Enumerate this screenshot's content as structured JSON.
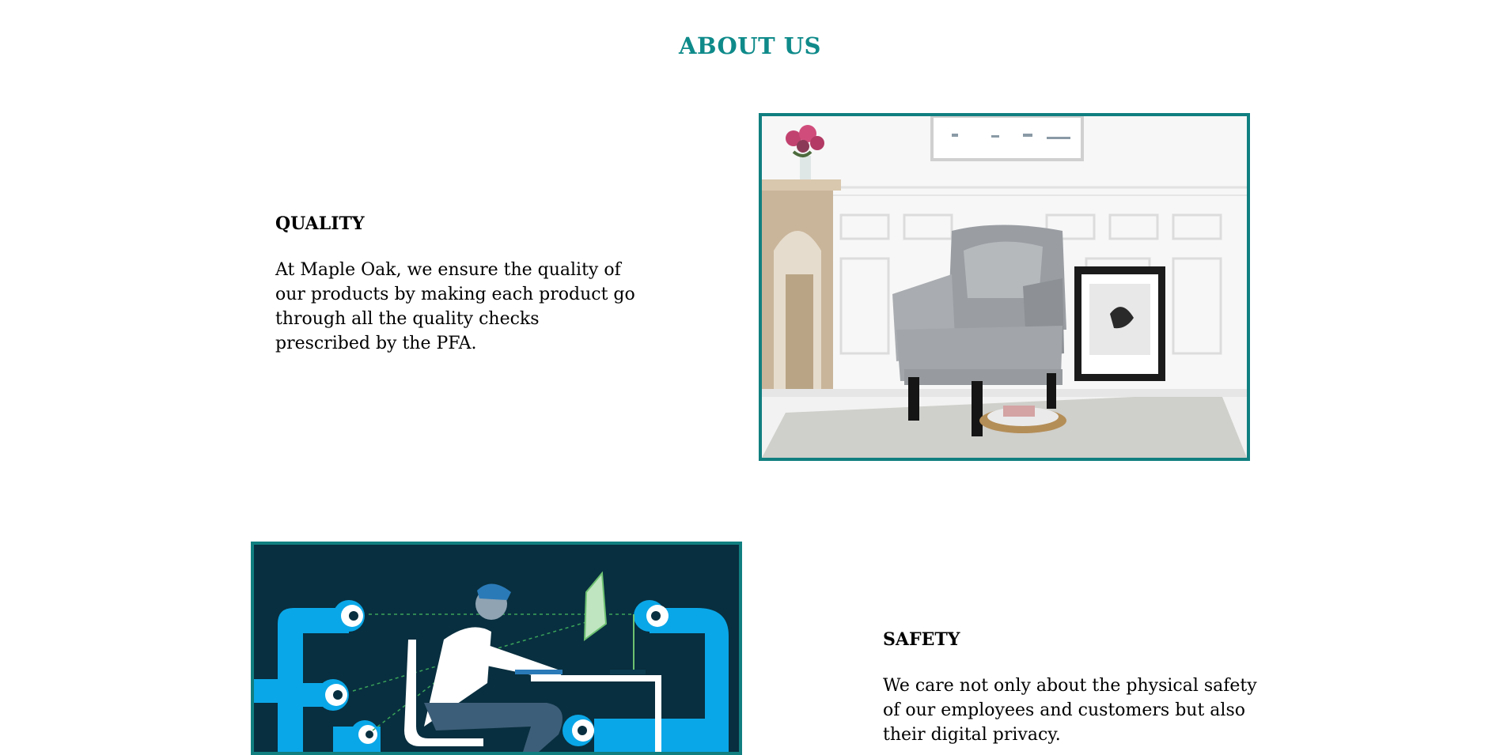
{
  "page": {
    "title": "ABOUT US"
  },
  "sections": [
    {
      "heading": "QUALITY",
      "text": "At Maple Oak, we ensure the quality of our products by making each product go through all the quality checks prescribed by the PFA.",
      "image_alt": "grey-armchair-photo"
    },
    {
      "heading": "SAFETY",
      "text": "We care not only about the physical safety of our employees and customers but also their digital privacy.",
      "image_alt": "digital-safety-illustration"
    }
  ],
  "colors": {
    "accent": "#0f8a8a",
    "frame_border": "#117f80",
    "illustration_bg": "#082f3f",
    "illustration_blue": "#0aa7e8"
  }
}
